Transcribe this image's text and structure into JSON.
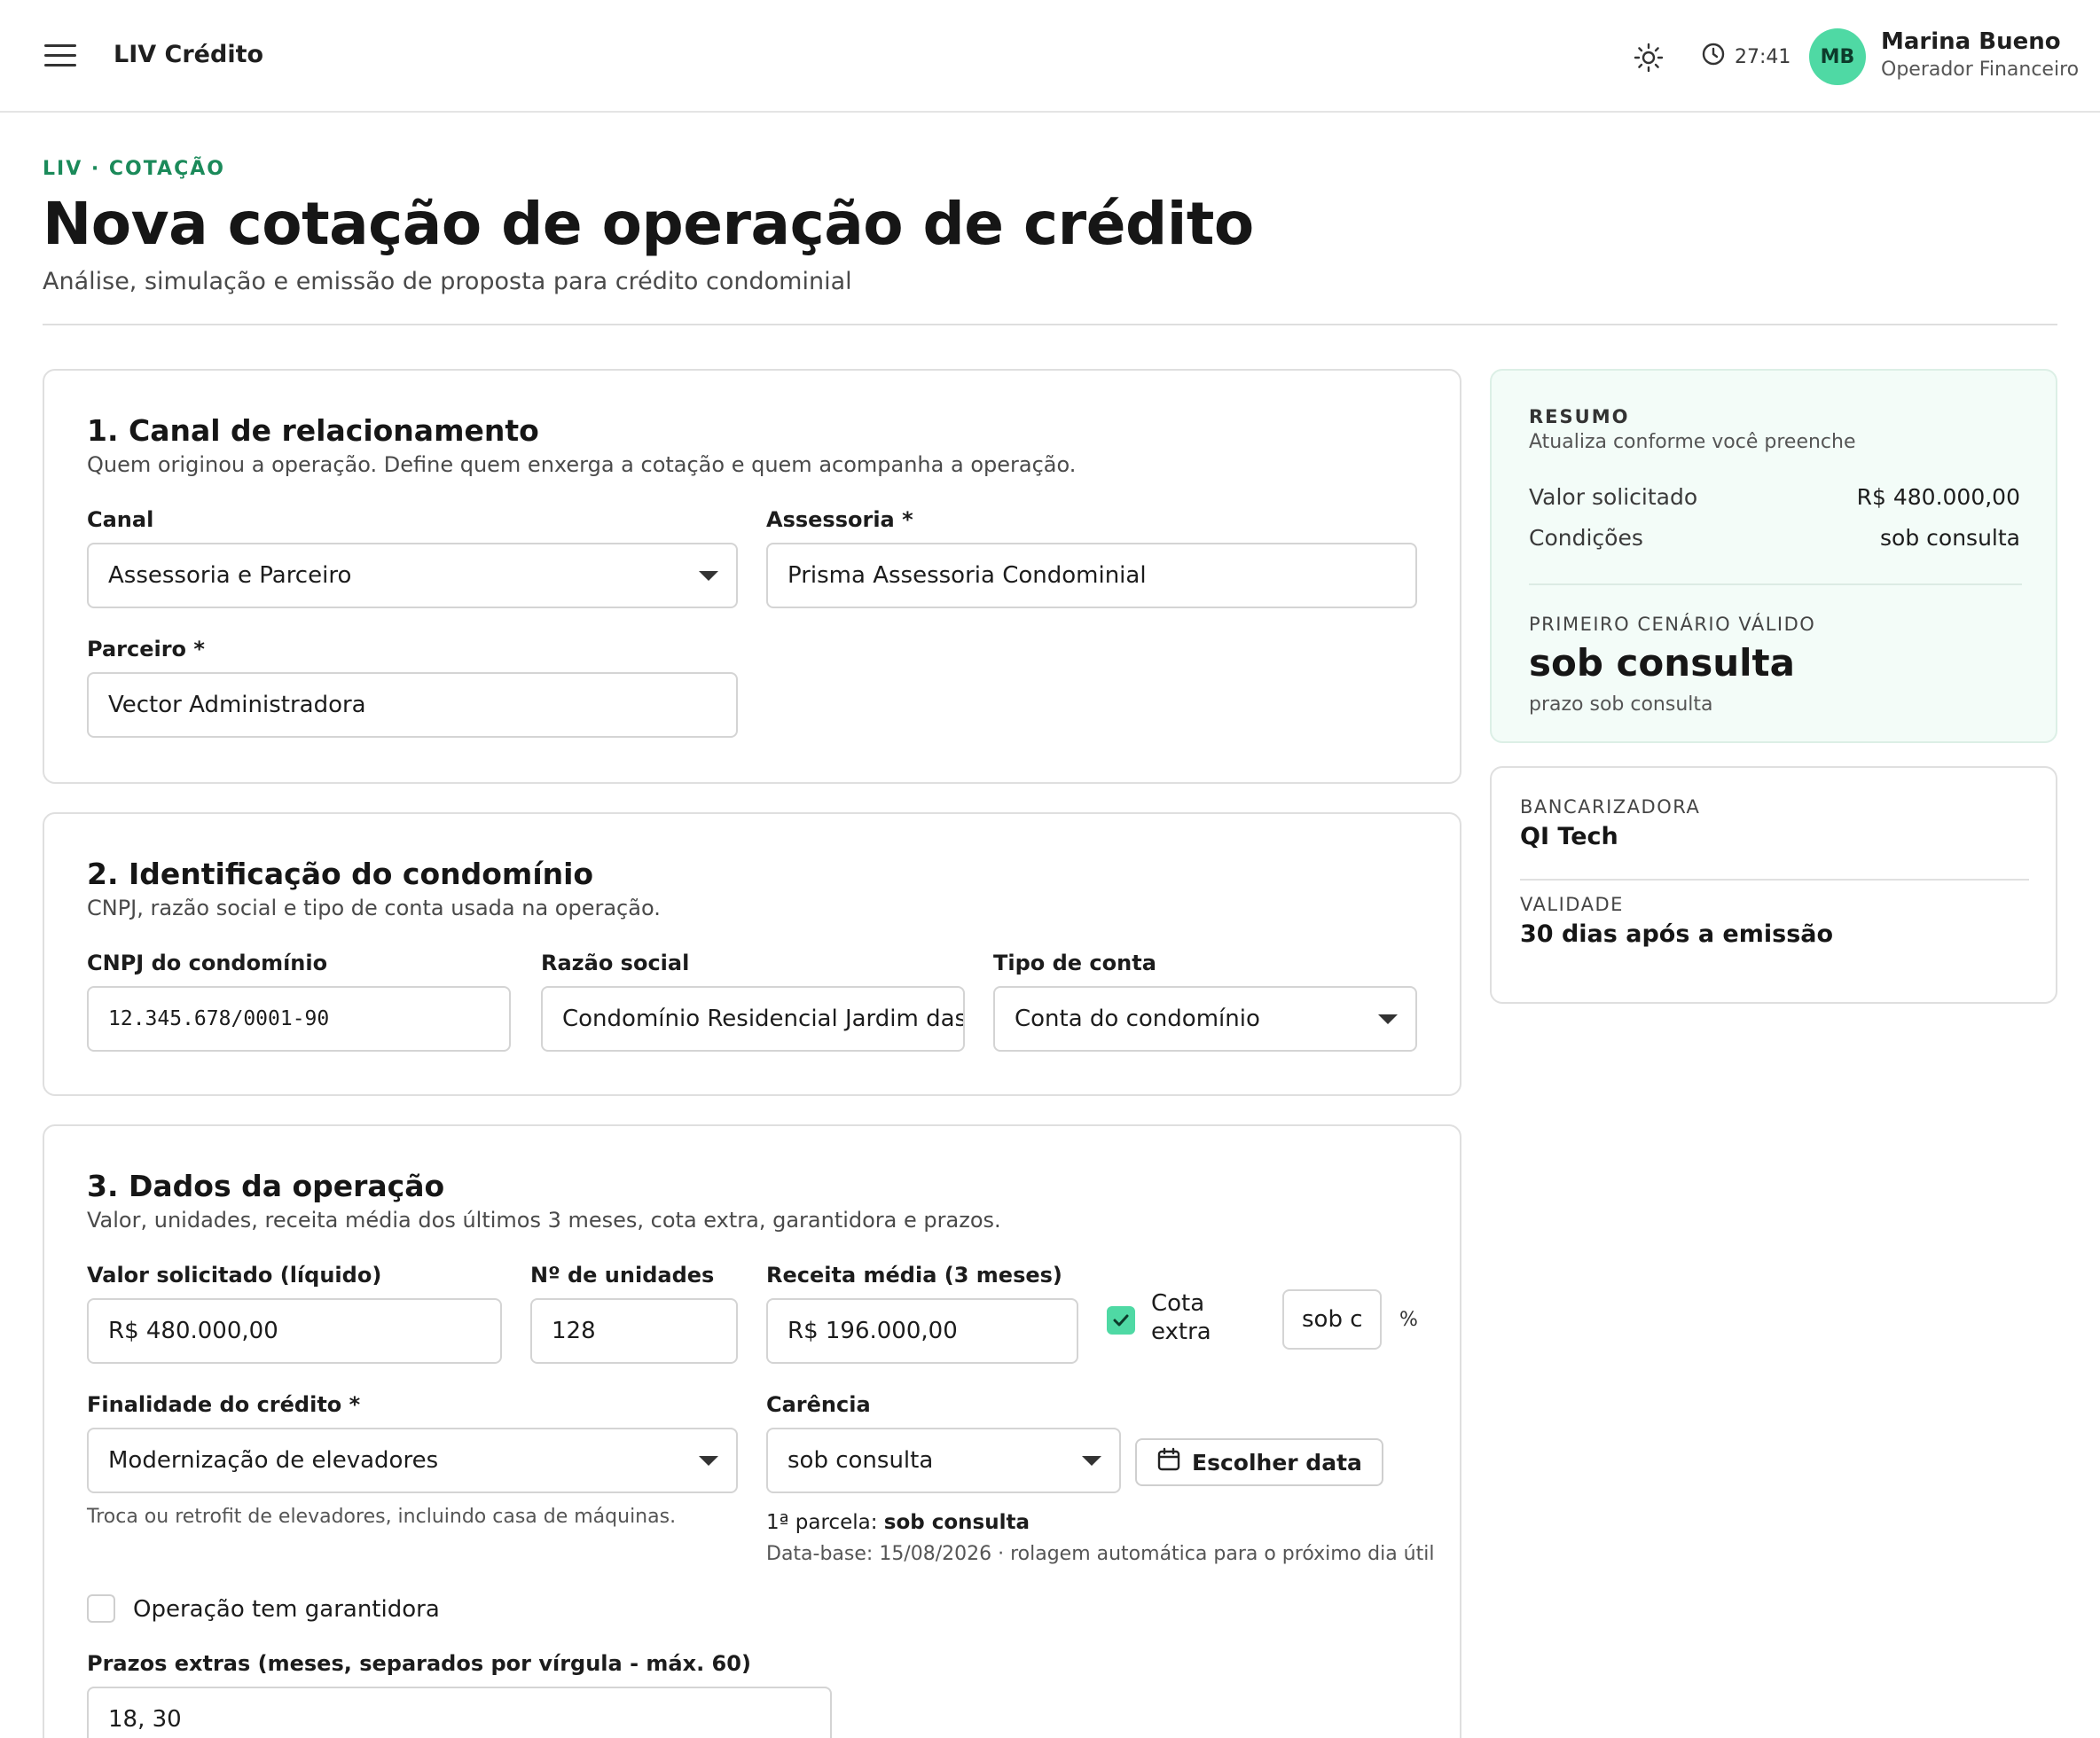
{
  "header": {
    "app_title": "LIV Crédito",
    "timer": "27:41",
    "user": {
      "initials": "MB",
      "name": "Marina Bueno",
      "role": "Operador Financeiro"
    }
  },
  "page": {
    "eyebrow": "LIV · COTAÇÃO",
    "title": "Nova cotação de operação de crédito",
    "subtitle": "Análise, simulação e emissão de proposta para crédito condominial"
  },
  "section1": {
    "title": "1. Canal de relacionamento",
    "description": "Quem originou a operação. Define quem enxerga a cotação e quem acompanha a operação.",
    "canal": {
      "label": "Canal",
      "value": "Assessoria e Parceiro"
    },
    "assessoria": {
      "label": "Assessoria *",
      "value": "Prisma Assessoria Condominial"
    },
    "parceiro": {
      "label": "Parceiro *",
      "value": "Vector Administradora"
    }
  },
  "section2": {
    "title": "2. Identificação do condomínio",
    "description": "CNPJ, razão social e tipo de conta usada na operação.",
    "cnpj": {
      "label": "CNPJ do condomínio",
      "value": "12.345.678/0001-90"
    },
    "razao": {
      "label": "Razão social",
      "value": "Condomínio Residencial Jardim das"
    },
    "tipo_conta": {
      "label": "Tipo de conta",
      "value": "Conta do condomínio"
    }
  },
  "section3": {
    "title": "3. Dados da operação",
    "description": "Valor, unidades, receita média dos últimos 3 meses, cota extra, garantidora e prazos.",
    "valor": {
      "label": "Valor solicitado (líquido)",
      "value": "R$ 480.000,00"
    },
    "unidades": {
      "label": "Nº de unidades",
      "value": "128"
    },
    "receita": {
      "label": "Receita média (3 meses)",
      "value": "R$ 196.000,00"
    },
    "cota_extra": {
      "label_line1": "Cota",
      "label_line2": "extra",
      "checked": true,
      "value": "sob c",
      "unit": "%"
    },
    "finalidade": {
      "label": "Finalidade do crédito *",
      "value": "Modernização de elevadores",
      "help": "Troca ou retrofit de elevadores, incluindo casa de máquinas."
    },
    "carencia": {
      "label": "Carência",
      "value": "sob consulta",
      "date_button": "Escolher data",
      "first_parcel_label": "1ª parcela: ",
      "first_parcel_value": "sob consulta",
      "base_date": "Data-base: 15/08/2026 · rolagem automática para o próximo dia útil"
    },
    "garantidora": {
      "label": "Operação tem garantidora",
      "checked": false
    },
    "prazos": {
      "label": "Prazos extras (meses, separados por vírgula - máx. 60)",
      "value": "18, 30"
    }
  },
  "summary": {
    "eyebrow": "RESUMO",
    "note": "Atualiza conforme você preenche",
    "rows": [
      {
        "label": "Valor solicitado",
        "value": "R$ 480.000,00"
      },
      {
        "label": "Condições",
        "value": "sob consulta"
      }
    ],
    "scenario_label": "PRIMEIRO CENÁRIO VÁLIDO",
    "scenario_value": "sob consulta",
    "scenario_sub": "prazo sob consulta"
  },
  "bank": {
    "bancarizadora_label": "BANCARIZADORA",
    "bancarizadora_value": "QI Tech",
    "validade_label": "VALIDADE",
    "validade_value": "30 dias após a emissão"
  },
  "colors": {
    "accent": "#4fd9a4",
    "eyebrow": "#1b8a5a",
    "summary_bg": "#f3fcf8"
  }
}
